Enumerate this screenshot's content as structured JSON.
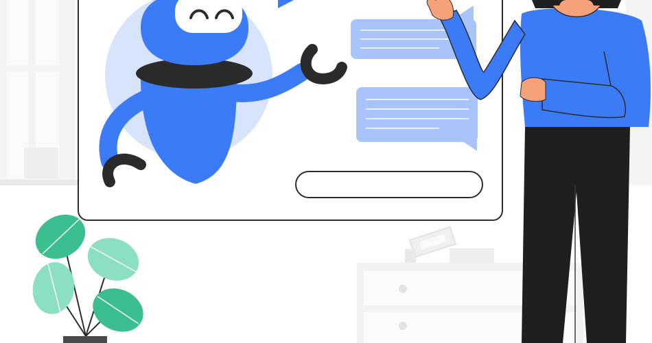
{
  "illustration": {
    "subject": "chatbot-conversation",
    "colors": {
      "robot_blue": "#3b7bf6",
      "robot_dark": "#2b2b2b",
      "halo": "#d7e4fb",
      "bubble": "#a9c4fb",
      "bubble_lines": "#ffffff",
      "window_border": "#2b2b2b",
      "leaf_dark": "#3bbf8f",
      "leaf_light": "#8be0bf",
      "shirt_blue": "#3b7bf6",
      "pants": "#1f1f1f",
      "skin": "#f5a27a",
      "background_shapes": "#f1f1f1"
    },
    "icons": [
      "robot-icon",
      "chat-bubble-icon",
      "plant-icon",
      "person-icon"
    ]
  },
  "chat": {
    "input_value": ""
  }
}
